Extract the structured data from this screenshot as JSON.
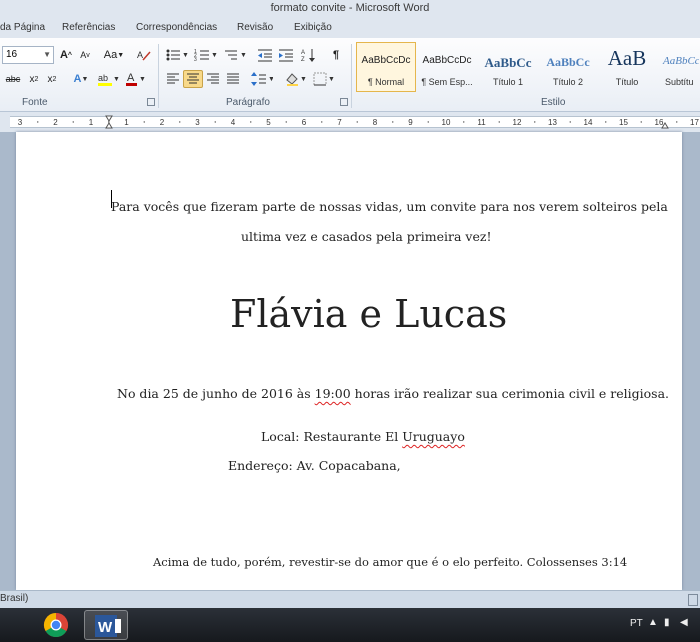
{
  "window": {
    "title": "formato convite  -  Microsoft Word"
  },
  "tabs": [
    "da Página",
    "Referências",
    "Correspondências",
    "Revisão",
    "Exibição"
  ],
  "ribbon": {
    "font_size": "16",
    "font_group_label": "Fonte",
    "paragraph_group_label": "Parágrafo",
    "styles_group_label": "Estilo",
    "change_case_label": "Aa",
    "font_color": "#c00000",
    "highlight_color": "#ffff00",
    "styles": [
      {
        "preview": "AaBbCcDc",
        "name": "¶ Normal",
        "active": true
      },
      {
        "preview": "AaBbCcDc",
        "name": "¶ Sem Esp..."
      },
      {
        "preview": "AaBbCc",
        "name": "Título 1"
      },
      {
        "preview": "AaBbCc",
        "name": "Título 2"
      },
      {
        "preview": "AaB",
        "name": "Título"
      },
      {
        "preview": "AaBbCcL",
        "name": "Subtítu"
      }
    ]
  },
  "ruler": {
    "numbers": [
      "3",
      "2",
      "1",
      "1",
      "2",
      "3",
      "4",
      "5",
      "6",
      "7",
      "8",
      "9",
      "10",
      "11",
      "12",
      "13",
      "14",
      "15",
      "16",
      "17"
    ]
  },
  "document": {
    "line1": "Para vocês que fizeram parte de nossas vidas, um convite para nos verem solteiros pela",
    "line2": "ultima vez e casados pela primeira vez!",
    "names": "Flávia e Lucas",
    "date_prefix": "No dia 25 de junho de 2016 às ",
    "date_time": "19:00",
    "date_suffix": " horas irão realizar sua cerimonia civil e religiosa.",
    "local_prefix": "Local: Restaurante El ",
    "local_name": "Uruguayo",
    "address": "Endereço: Av. Copacabana,",
    "verse": "Acima de tudo, porém, revestir-se do amor que é o elo perfeito. Colossenses 3:14"
  },
  "statusbar": {
    "language": "Brasil)"
  },
  "taskbar": {
    "tray_lang": "PT"
  }
}
